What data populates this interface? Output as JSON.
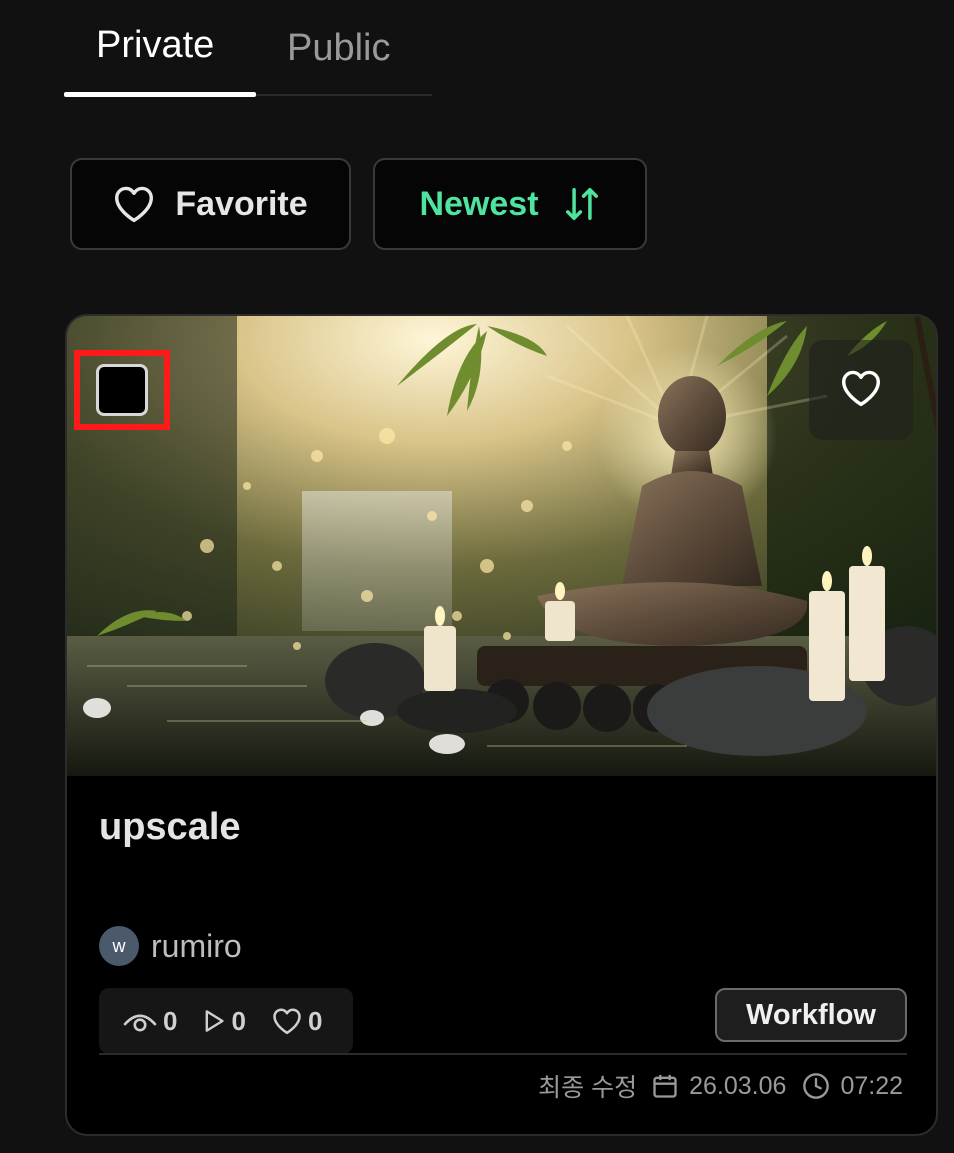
{
  "tabs": [
    {
      "label": "Private",
      "active": true
    },
    {
      "label": "Public",
      "active": false
    }
  ],
  "filters": {
    "favorite_label": "Favorite",
    "sort_label": "Newest",
    "sort_color": "#4fe3a0"
  },
  "card": {
    "title": "upscale",
    "author": {
      "initial": "w",
      "name": "rumiro"
    },
    "stats": {
      "views": "0",
      "runs": "0",
      "likes": "0"
    },
    "type_badge": "Workflow",
    "modified_label": "최종 수정",
    "date": "26.03.06",
    "time": "07:22",
    "selected": false,
    "favorited": false
  },
  "icons": {
    "favorite": "heart-icon",
    "sort": "sort-arrows-icon",
    "views": "eye-icon",
    "runs": "play-icon",
    "likes": "heart-icon",
    "date": "calendar-icon",
    "time": "clock-icon"
  }
}
